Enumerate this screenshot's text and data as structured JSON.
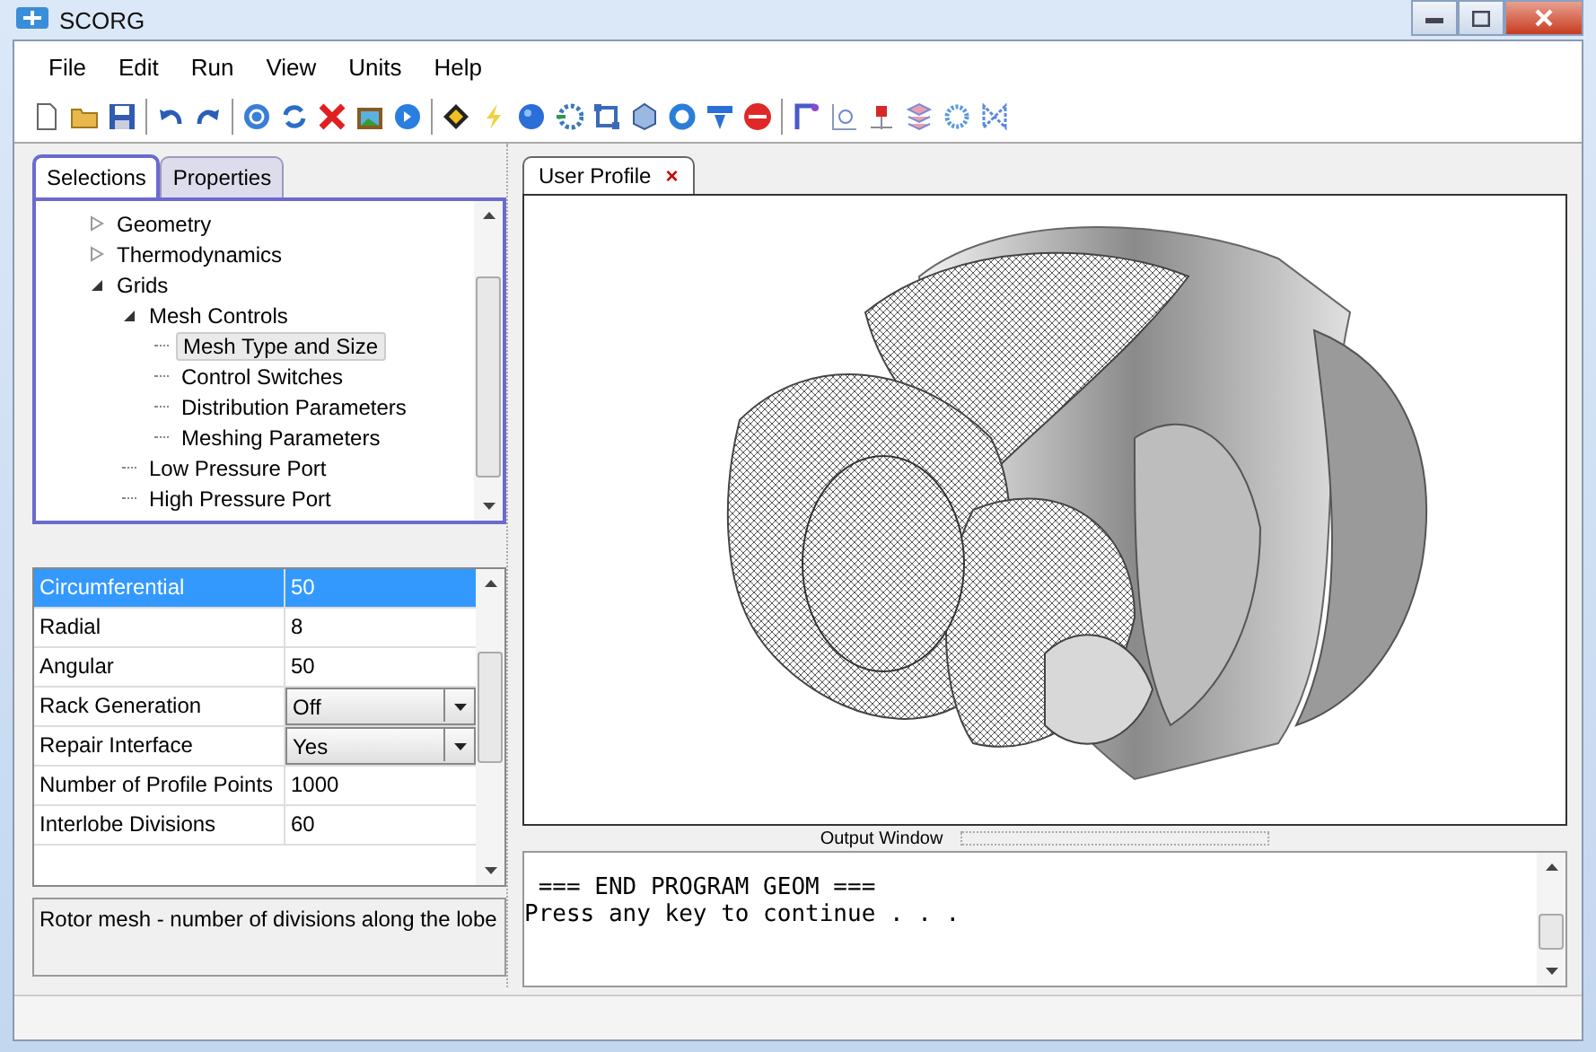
{
  "window": {
    "title": "SCORG"
  },
  "menu": [
    "File",
    "Edit",
    "Run",
    "View",
    "Units",
    "Help"
  ],
  "left_tabs": [
    {
      "label": "Selections",
      "selected": true
    },
    {
      "label": "Properties",
      "selected": false
    }
  ],
  "tree": [
    {
      "label": "Geometry",
      "expanded": false,
      "selected": false
    },
    {
      "label": "Thermodynamics",
      "expanded": false,
      "selected": false
    },
    {
      "label": "Grids",
      "expanded": true,
      "selected": false,
      "children": [
        {
          "label": "Mesh Controls",
          "expanded": true,
          "selected": false,
          "children": [
            {
              "label": "Mesh Type and Size",
              "selected": true
            },
            {
              "label": "Control Switches",
              "selected": false
            },
            {
              "label": "Distribution Parameters",
              "selected": false
            },
            {
              "label": "Meshing Parameters",
              "selected": false
            }
          ]
        },
        {
          "label": "Low Pressure Port",
          "selected": false
        },
        {
          "label": "High Pressure Port",
          "selected": false
        }
      ]
    }
  ],
  "properties": [
    {
      "name": "Circumferential",
      "value": "50",
      "kind": "text",
      "selected": true
    },
    {
      "name": "Radial",
      "value": "8",
      "kind": "text",
      "selected": false
    },
    {
      "name": "Angular",
      "value": "50",
      "kind": "text",
      "selected": false
    },
    {
      "name": "Rack Generation",
      "value": "Off",
      "kind": "dropdown",
      "selected": false
    },
    {
      "name": "Repair Interface",
      "value": "Yes",
      "kind": "dropdown",
      "selected": false
    },
    {
      "name": "Number of Profile Points",
      "value": "1000",
      "kind": "text",
      "selected": false
    },
    {
      "name": "Interlobe Divisions",
      "value": "60",
      "kind": "text",
      "selected": false
    }
  ],
  "description": "Rotor mesh - number of divisions along the lobe",
  "document_tabs": [
    {
      "label": "User Profile",
      "close": "×"
    }
  ],
  "output_window": {
    "title": "Output Window",
    "lines": [
      " === END PROGRAM GEOM ===",
      "Press any key to continue . . ."
    ]
  }
}
